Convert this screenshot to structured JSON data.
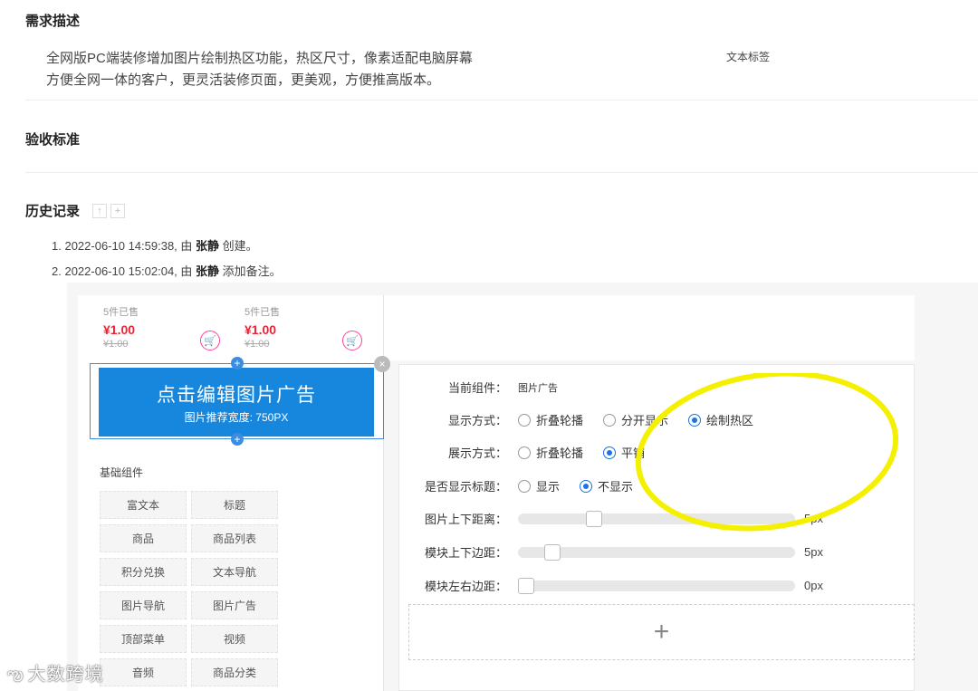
{
  "requirements": {
    "heading": "需求描述",
    "line1": "全网版PC端装修增加图片绘制热区功能，热区尺寸，像素适配电脑屏幕",
    "line2": "方便全网一体的客户，更灵活装修页面，更美观，方便推高版本。",
    "tag_label": "文本标签"
  },
  "acceptance": {
    "heading": "验收标准"
  },
  "history": {
    "heading": "历史记录",
    "up_icon": "arrow-up-icon",
    "add_icon": "plus-icon",
    "entries": [
      {
        "index": "1.",
        "time": "2022-06-10 14:59:38, 由",
        "user": "张静",
        "action": "创建。"
      },
      {
        "index": "2.",
        "time": "2022-06-10 15:02:04, 由",
        "user": "张静",
        "action": "添加备注。"
      }
    ]
  },
  "editor": {
    "products": [
      {
        "sold": "5件已售",
        "price": "¥1.00",
        "old_price": "¥1.00"
      },
      {
        "sold": "5件已售",
        "price": "¥1.00",
        "old_price": "¥1.00"
      }
    ],
    "banner": {
      "title": "点击编辑图片广告",
      "subtitle": "图片推荐宽度: 750PX"
    },
    "components_heading": "基础组件",
    "components": [
      "富文本",
      "标题",
      "商品",
      "商品列表",
      "积分兑换",
      "文本导航",
      "图片导航",
      "图片广告",
      "顶部菜单",
      "视频",
      "音频",
      "商品分类"
    ],
    "config": {
      "current_label": "当前组件：",
      "current_value": "图片广告",
      "display_mode": {
        "label": "显示方式：",
        "options": [
          "折叠轮播",
          "分开显示",
          "绘制热区"
        ],
        "selected": 2
      },
      "show_mode": {
        "label": "展示方式：",
        "options": [
          "折叠轮播",
          "平铺"
        ],
        "selected": 1
      },
      "show_title": {
        "label": "是否显示标题：",
        "options": [
          "显示",
          "不显示"
        ],
        "selected": 1
      },
      "sliders": [
        {
          "label": "图片上下距离：",
          "value": "5px",
          "level": 0.26
        },
        {
          "label": "模块上下边距：",
          "value": "5px",
          "level": 0.1
        },
        {
          "label": "模块左右边距：",
          "value": "0px",
          "level": 0.0
        }
      ],
      "add_label": "+"
    }
  },
  "watermark": "大数跨境",
  "highlight_color": "#f5f000"
}
